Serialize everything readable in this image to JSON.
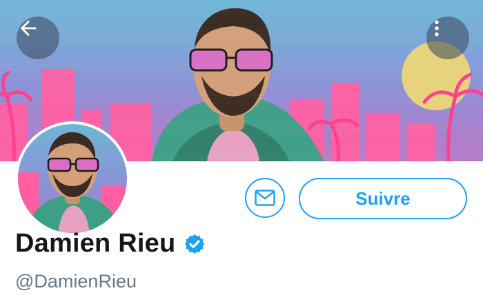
{
  "profile": {
    "display_name": "Damien Rieu",
    "handle": "@DamienRieu",
    "verified": true
  },
  "actions": {
    "follow_label": "Suivre",
    "message_icon": "envelope-icon"
  },
  "navigation": {
    "back_icon": "arrow-left-icon",
    "menu_icon": "more-vertical-icon"
  },
  "colors": {
    "accent": "#1da1f2",
    "name_text": "#14171a",
    "handle_text": "#657786",
    "banner_sky": "#8e8fd6",
    "banner_pink": "#ff5fa2",
    "banner_sun": "#e6d27a",
    "scarf_green": "#3f9e86"
  }
}
